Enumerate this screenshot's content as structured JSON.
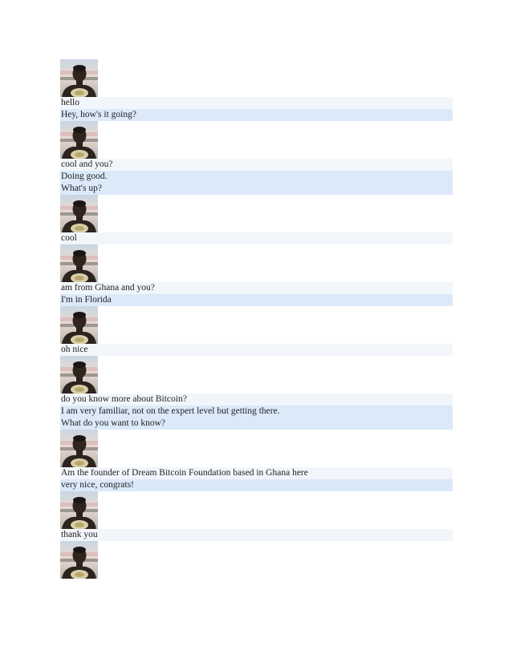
{
  "conversation": {
    "blocks": [
      {
        "type": "avatar"
      },
      {
        "type": "them",
        "lines": [
          "hello"
        ]
      },
      {
        "type": "me",
        "lines": [
          "Hey, how's it going?"
        ]
      },
      {
        "type": "avatar"
      },
      {
        "type": "them",
        "lines": [
          "cool and you?"
        ]
      },
      {
        "type": "me",
        "lines": [
          "Doing good.",
          "What's up?"
        ]
      },
      {
        "type": "avatar"
      },
      {
        "type": "them",
        "lines": [
          "cool"
        ]
      },
      {
        "type": "avatar"
      },
      {
        "type": "them",
        "lines": [
          "am from Ghana and you?"
        ]
      },
      {
        "type": "me",
        "lines": [
          "I'm in Florida"
        ]
      },
      {
        "type": "avatar"
      },
      {
        "type": "them",
        "lines": [
          "oh nice"
        ]
      },
      {
        "type": "avatar"
      },
      {
        "type": "them",
        "lines": [
          "do you know more about Bitcoin?"
        ]
      },
      {
        "type": "me",
        "lines": [
          "I am very familiar, not on the expert level but getting there.",
          "What do you want to know?"
        ]
      },
      {
        "type": "avatar"
      },
      {
        "type": "them",
        "lines": [
          "Am the founder of Dream Bitcoin Foundation based in Ghana here"
        ]
      },
      {
        "type": "me",
        "lines": [
          "very nice, congrats!"
        ]
      },
      {
        "type": "avatar"
      },
      {
        "type": "them",
        "lines": [
          "thank you"
        ]
      },
      {
        "type": "avatar"
      }
    ]
  },
  "colors": {
    "them_background": "#f2f6fb",
    "me_background": "#dbe9f9"
  }
}
